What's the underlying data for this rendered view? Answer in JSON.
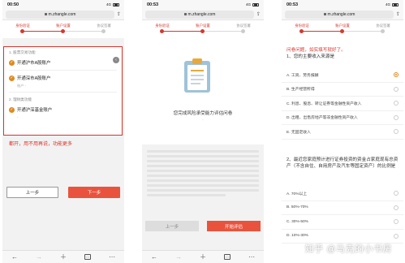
{
  "phones": [
    {
      "time": "00:50",
      "signal": "4G",
      "url": "m.zhangle.com",
      "steps": [
        "身份验证",
        "账户设置",
        "协议签署"
      ],
      "section1": "1. 股票交易功能",
      "items1": [
        "开通沪市A股账户",
        "开通深市A股账户"
      ],
      "sub1": "账户 -",
      "section2": "2. 理财类功能",
      "items2": [
        "开通沪深基金账户"
      ],
      "sub2": "-",
      "note": "都开，用不用再说，功能更多",
      "prev": "上一步",
      "next": "下一步"
    },
    {
      "time": "00:53",
      "signal": "4G",
      "url": "m.zhangle.com",
      "steps": [
        "身份验证",
        "账户设置",
        "协议签署"
      ],
      "title": "您完成风险承受能力评估问卷",
      "subtitle": "-",
      "prev": "上一步",
      "start": "开始评估"
    },
    {
      "time": "00:53",
      "signal": "4G",
      "url": "m.zhangle.com",
      "steps": [
        "身份验证",
        "账户设置",
        "协议签署"
      ],
      "note": "问卷问题，如实填写就好了。",
      "q1": "1、您的主要收入来源是",
      "options1": [
        "A. 工资、劳务报酬",
        "B. 生产经营所得",
        "C. 利息、股息、转让证券等金融性资产收入",
        "D. 出租、出售房地产等非金融性资产收入",
        "E. 无固定收入"
      ],
      "q2": "2、最近您家庭预计进行证券投资的资金占家庭现有总资产（不含自住、自用房产及汽车等固定资产）的比例是",
      "options2": [
        "A. 70%以上",
        "B. 50%-70%",
        "C. 30%-50%",
        "D. 10%-30%"
      ]
    }
  ],
  "watermark": "知乎 @马克的小书房",
  "colors": {
    "accent": "#d23a32",
    "button": "#e9533d",
    "check": "#e08a1d"
  }
}
